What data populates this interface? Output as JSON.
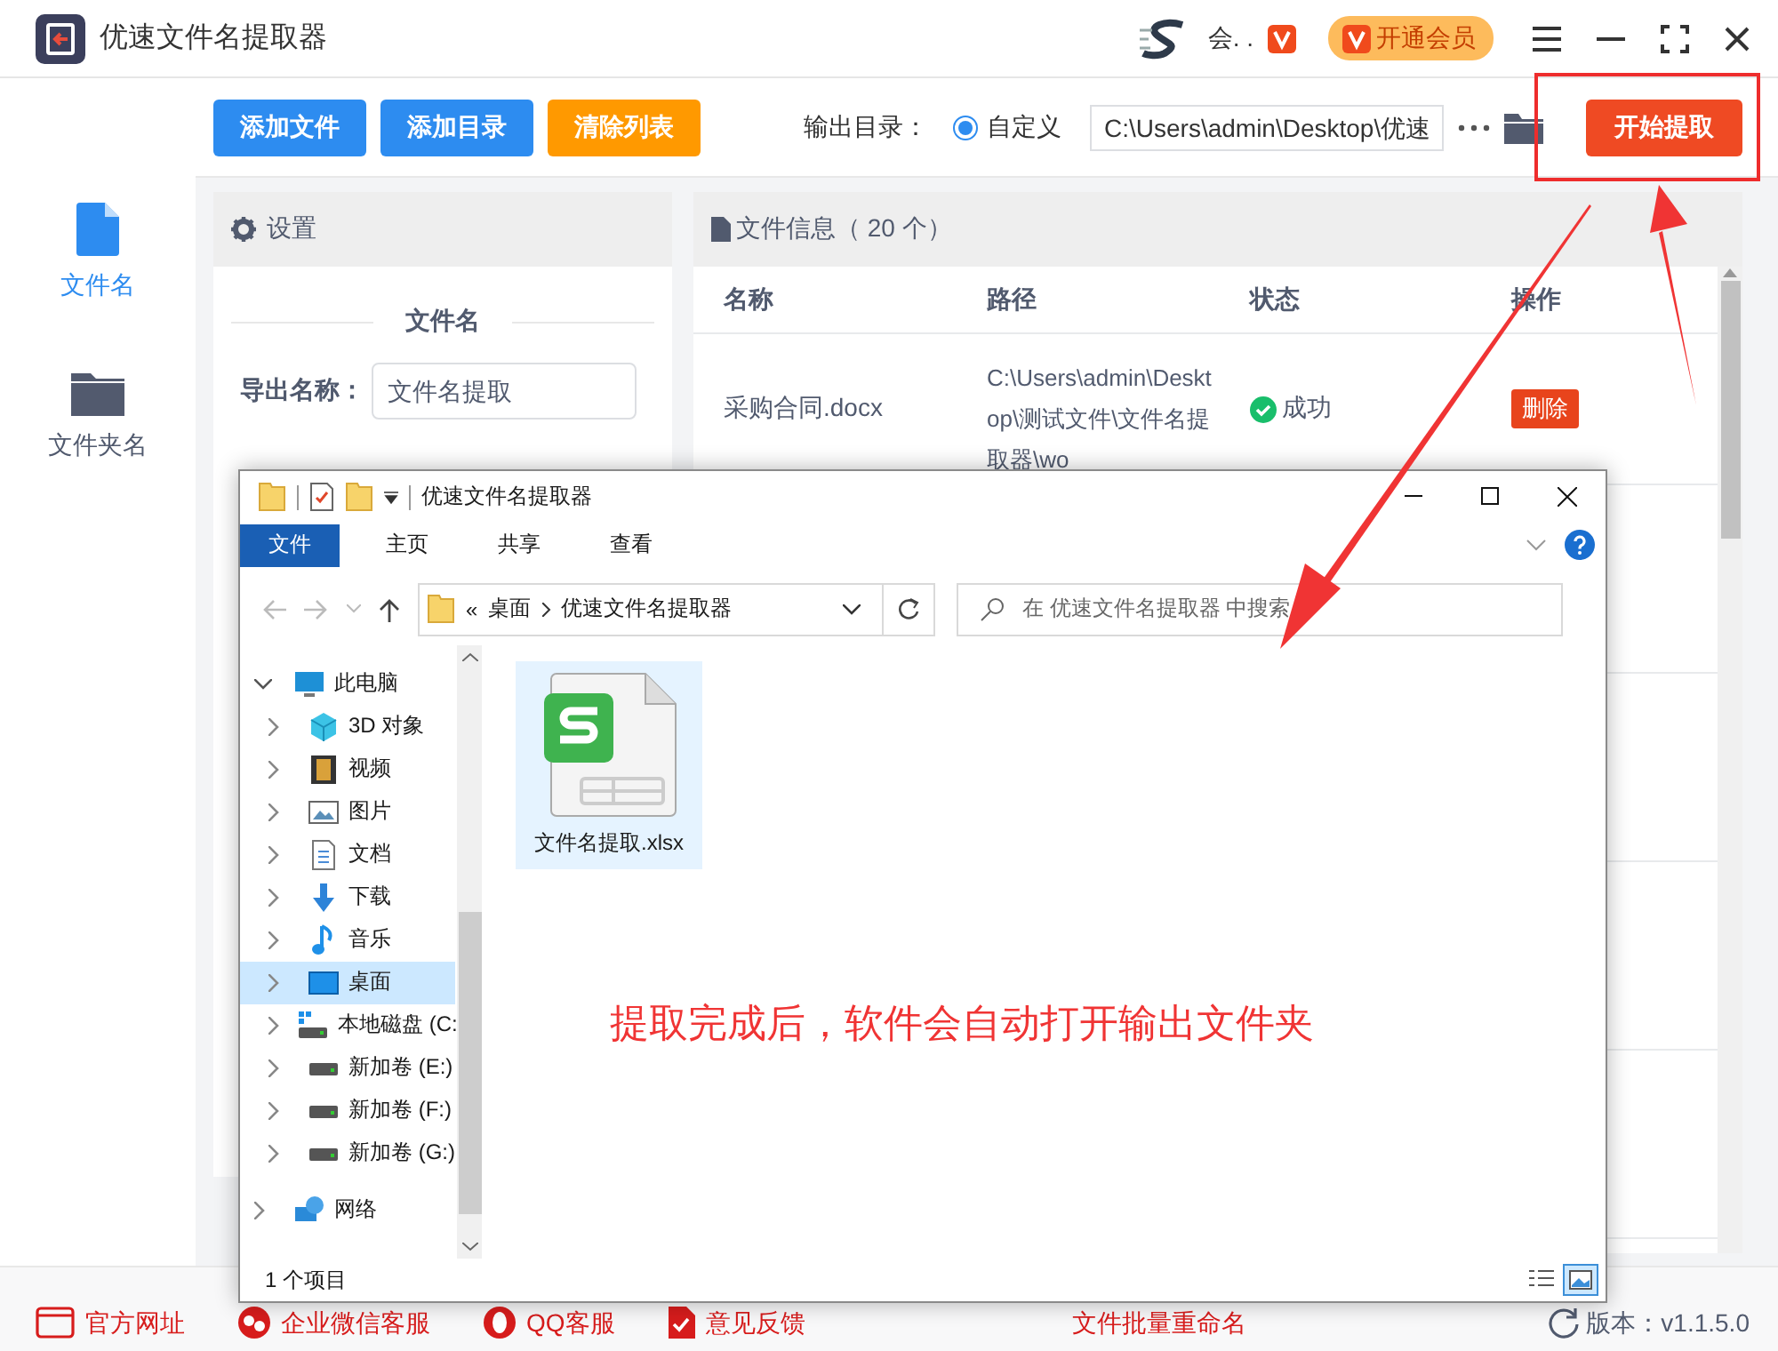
{
  "app": {
    "title": "优速文件名提取器",
    "user_name": "会. .",
    "vip_button": "开通会员"
  },
  "toolbar": {
    "buttons": [
      {
        "label": "添加文件",
        "color": "#2d8cf0"
      },
      {
        "label": "添加目录",
        "color": "#2d8cf0"
      },
      {
        "label": "清除列表",
        "color": "#ff9900"
      }
    ],
    "output_label": "输出目录：",
    "radio": {
      "label": "自定义",
      "selected": true
    },
    "output_path": "C:\\Users\\admin\\Desktop\\优速",
    "start_button": "开始提取"
  },
  "sidebar": {
    "items": [
      {
        "label": "文件名",
        "kind": "file",
        "selected": true
      },
      {
        "label": "文件夹名",
        "kind": "folder",
        "selected": false
      }
    ]
  },
  "settings": {
    "title": "设置",
    "section": "文件名",
    "fields": [
      {
        "label": "导出名称：",
        "value": "文件名提取"
      }
    ]
  },
  "file_info": {
    "title": "文件信息（ 20 个）",
    "columns": [
      "名称",
      "路径",
      "状态",
      "操作"
    ],
    "rows": [
      {
        "name": "采购合同.docx",
        "path": "C:\\Users\\admin\\Desktop\\测试文件\\文件名提取器\\wo",
        "status": "成功",
        "action": "删除"
      }
    ]
  },
  "explorer": {
    "title": "优速文件名提取器",
    "ribbon_tabs": [
      {
        "label": "文件",
        "selected": true
      },
      {
        "label": "主页",
        "selected": false
      },
      {
        "label": "共享",
        "selected": false
      },
      {
        "label": "查看",
        "selected": false
      }
    ],
    "overflow_mark": "«",
    "breadcrumb": [
      "桌面",
      "优速文件名提取器"
    ],
    "search_placeholder": "在 优速文件名提取器 中搜索",
    "nav": [
      {
        "label": "此电脑",
        "kind": "pc",
        "expanded": true,
        "selected": false,
        "children": [
          {
            "label": "3D 对象",
            "kind": "cube",
            "expanded": false,
            "selected": false
          },
          {
            "label": "视频",
            "kind": "film",
            "expanded": false,
            "selected": false
          },
          {
            "label": "图片",
            "kind": "image",
            "expanded": false,
            "selected": false
          },
          {
            "label": "文档",
            "kind": "doc",
            "expanded": false,
            "selected": false
          },
          {
            "label": "下载",
            "kind": "download",
            "expanded": false,
            "selected": false
          },
          {
            "label": "音乐",
            "kind": "music",
            "expanded": false,
            "selected": false
          },
          {
            "label": "桌面",
            "kind": "desktop",
            "expanded": false,
            "selected": true
          },
          {
            "label": "本地磁盘 (C:",
            "kind": "disk-c",
            "expanded": false,
            "selected": false
          },
          {
            "label": "新加卷 (E:)",
            "kind": "disk",
            "expanded": false,
            "selected": false
          },
          {
            "label": "新加卷 (F:)",
            "kind": "disk",
            "expanded": false,
            "selected": false
          },
          {
            "label": "新加卷 (G:)",
            "kind": "disk",
            "expanded": false,
            "selected": false
          }
        ]
      },
      {
        "label": "网络",
        "kind": "network",
        "expanded": false,
        "selected": false
      }
    ],
    "files": [
      {
        "name": "文件名提取.xlsx",
        "selected": true
      }
    ],
    "status": "1 个项目"
  },
  "annotation": "提取完成后，软件会自动打开输出文件夹",
  "footer": {
    "links": [
      {
        "label": "官方网址",
        "kind": "web"
      },
      {
        "label": "企业微信客服",
        "kind": "wechat"
      },
      {
        "label": "QQ客服",
        "kind": "qq"
      },
      {
        "label": "意见反馈",
        "kind": "feedback"
      }
    ],
    "rename_link": "文件批量重命名",
    "version": "版本：v1.1.5.0"
  }
}
